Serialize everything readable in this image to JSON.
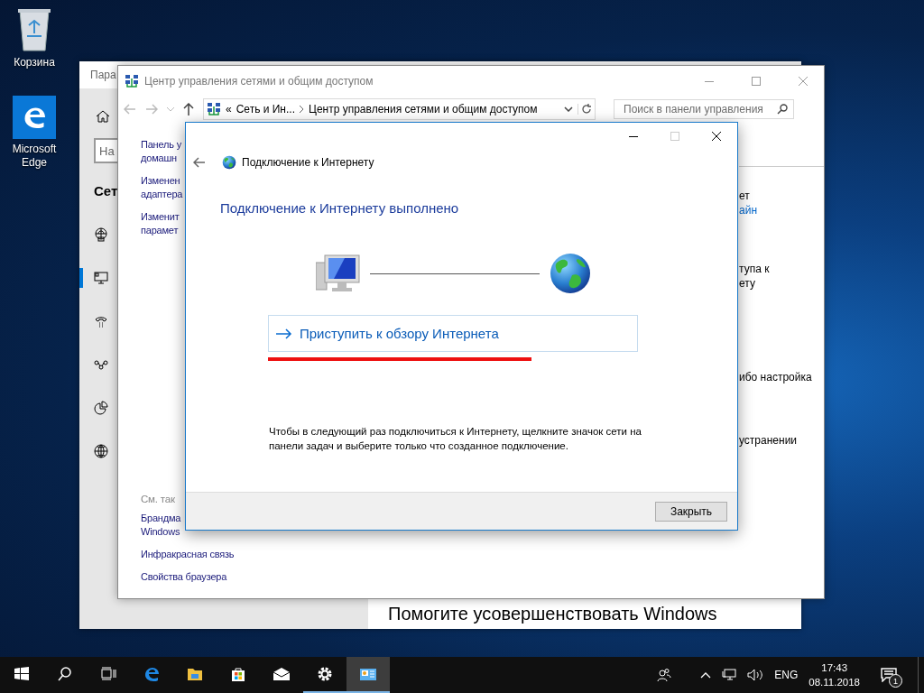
{
  "desktop_icons": [
    {
      "kind": "bin",
      "label": "Корзина"
    },
    {
      "kind": "edge",
      "label": "Microsoft Edge"
    }
  ],
  "settings_window": {
    "title": "Пара",
    "search": {
      "placeholder": "На"
    },
    "heading": "Сет",
    "nav": [
      {
        "kind": "globe-network",
        "selected": false
      },
      {
        "kind": "monitor",
        "selected": true
      },
      {
        "kind": "phone",
        "selected": false
      },
      {
        "kind": "vpn",
        "selected": false
      },
      {
        "kind": "pie",
        "selected": false
      },
      {
        "kind": "globe",
        "selected": false
      }
    ],
    "footer_text": "Помогите усовершенствовать Windows"
  },
  "control_panel": {
    "title": "Центр управления сетями и общим доступом",
    "overflow": "«",
    "breadcrumb": [
      "Сеть и Ин...",
      "Центр управления сетями и общим доступом"
    ],
    "search": {
      "placeholder": "Поиск в панели управления"
    },
    "tasks": [
      [
        "Панель у",
        "домашн"
      ],
      [
        "Изменен",
        "адаптера"
      ],
      [
        "Изменит",
        "парамет"
      ]
    ],
    "see_also_title": "См. так",
    "see_also": [
      [
        "Брандма",
        "Windows"
      ],
      [
        "Инфракрасная связь"
      ],
      [
        "Свойства браузера"
      ]
    ],
    "right_groups": [
      [
        {
          "kind": "plain",
          "text": "ет"
        },
        {
          "kind": "link",
          "text": "айн"
        }
      ],
      [
        {
          "kind": "plain",
          "text": "тупа к"
        },
        {
          "kind": "plain",
          "text": "ету"
        }
      ],
      [
        {
          "kind": "plain",
          "text": "ибо настройка"
        }
      ],
      [
        {
          "kind": "plain",
          "text": "устранении"
        }
      ]
    ]
  },
  "dialog": {
    "title": "Подключение к Интернету",
    "heading": "Подключение к Интернету выполнено",
    "command": "Приступить к обзору Интернета",
    "annotation_underline": true,
    "note": "Чтобы в следующий раз подключиться к Интернету, щелкните значок сети на панели задач и выберите только что созданное подключение.",
    "close_button": "Закрыть"
  },
  "taskbar": {
    "buttons": [
      {
        "kind": "start",
        "running": false,
        "selected": false
      },
      {
        "kind": "search",
        "running": false,
        "selected": false
      },
      {
        "kind": "taskview",
        "running": false,
        "selected": false
      },
      {
        "kind": "edge",
        "running": false,
        "selected": false
      },
      {
        "kind": "explorer",
        "running": false,
        "selected": false
      },
      {
        "kind": "store",
        "running": false,
        "selected": false
      },
      {
        "kind": "mail",
        "running": false,
        "selected": false
      },
      {
        "kind": "settings",
        "running": true,
        "selected": false
      },
      {
        "kind": "controlpanel",
        "running": true,
        "selected": true
      }
    ],
    "language": "ENG",
    "time": "17:43",
    "date": "08.11.2018",
    "notification_count": "1"
  }
}
